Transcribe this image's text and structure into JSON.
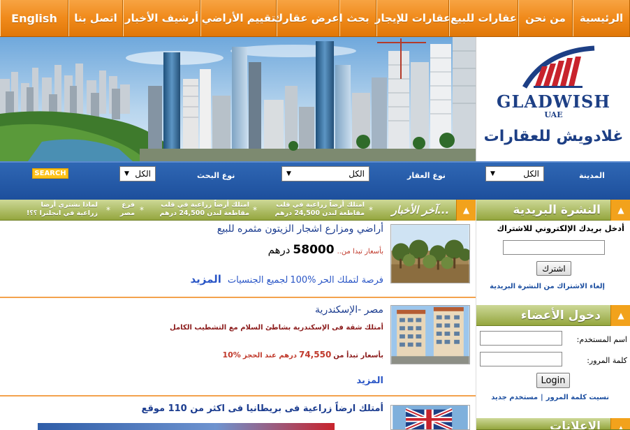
{
  "nav": {
    "items": [
      "الرئيسية",
      "من نحن",
      "عقارات للبيع",
      "عقارات للإيجار",
      "بحث",
      "اعرض عقارك",
      "تقييم الأراضي",
      "أرشيف الأخبار",
      "اتصل بنا",
      "English"
    ]
  },
  "logo": {
    "name": "GLADWISH",
    "sub": "UAE",
    "arabic": "غلادويش للعقارات"
  },
  "search": {
    "city_label": "المدينة",
    "city_value": "الكل",
    "type_label": "نوع العقار",
    "type_value": "الكل",
    "search_type_label": "نوع البحث",
    "search_type_value": "الكل",
    "button": "SEARCH"
  },
  "news": {
    "heading": "آخر الأخبار...",
    "ticker": [
      "امتلك أرضاً زراعية في قلب مقاطعة لندن 24,500 درهم",
      "امتلك أرضاً زراعية في قلب مقاطعة لندن 24,500 درهم",
      "فرع مصر",
      "لماذا نشتري أرضا زراعية في انجلترا ؟؟!"
    ]
  },
  "listings": [
    {
      "title": "أراضي ومزارع اشجار الزيتون مثمره للبيع",
      "price_prefix": "بأسعار تبدا من..",
      "price": "58000",
      "price_unit": "درهم",
      "promo_prefix": "فرصة لتملك الحر",
      "promo_percent": "100%",
      "promo_suffix": "لجميع الجنسيات",
      "more": "المزيد"
    },
    {
      "title": "مصر -الإسكندرية",
      "desc": "أمتلك شقة فى الإسكندرية بشاطئ السلام مع التشطيب الكامل",
      "price_text": "بأسعار تبدأ من",
      "price_value": "74,550",
      "price_tail": "درهم عند الحجز",
      "percent": "10%",
      "more": "المزيد"
    },
    {
      "title": "أمتلك ارضاً زراعية فى بريطانيا فى اكثر من 110 موقع"
    }
  ],
  "newsletter": {
    "heading": "النشرة البريدية",
    "prompt": "أدخل بريدك الإلكتروني للاشتراك",
    "email_value": "",
    "subscribe": "اشترك",
    "unsubscribe": "إلغاء الاشتراك من النشرة البريدية"
  },
  "login": {
    "heading": "دخول الأعضاء",
    "user_label": "اسم المستخدم:",
    "user_value": "",
    "pass_label": "كلمة المرور:",
    "pass_value": "",
    "button": "Login",
    "forgot": "نسيت كلمة المرور",
    "separator": "|",
    "new_user": "مستخدم جديد"
  },
  "next_section": {
    "heading": "الإعلانات"
  },
  "colors": {
    "nav_orange": "#f08a1a",
    "search_blue": "#1d4f9c",
    "olive_header": "#94a63e",
    "link_blue": "#1b3c8f",
    "price_red": "#c0392b"
  }
}
